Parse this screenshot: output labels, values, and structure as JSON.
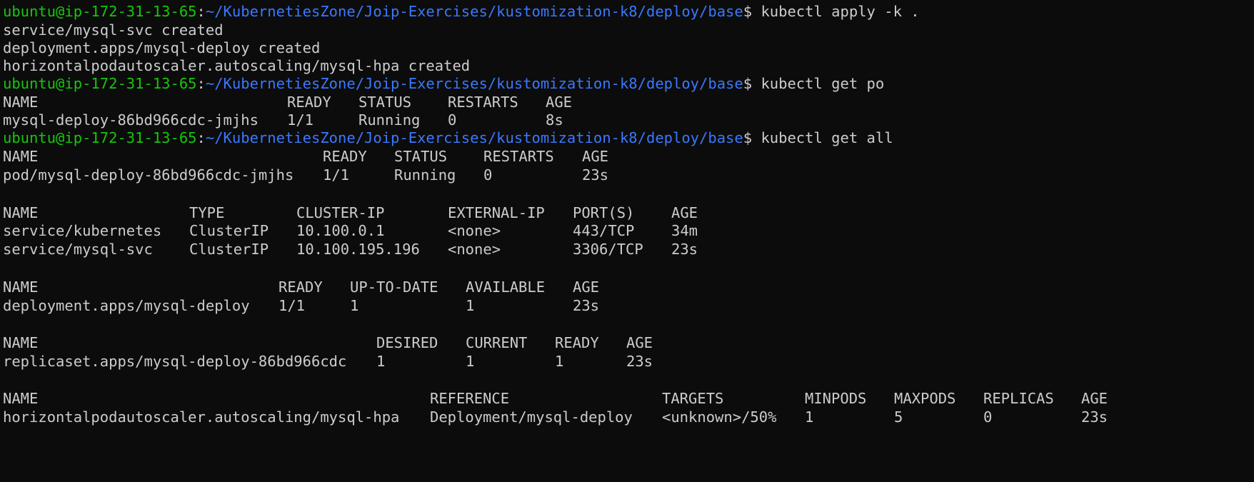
{
  "prompt": {
    "user_host": "ubuntu@ip-172-31-13-65",
    "separator": ":",
    "cwd": "~/KubernetiesZone/Joip-Exercises/kustomization-k8/deploy/base",
    "symbol": "$ "
  },
  "commands": {
    "apply": "kubectl apply -k .",
    "get_po": "kubectl get po",
    "get_all": "kubectl get all"
  },
  "apply_output": [
    "service/mysql-svc created",
    "deployment.apps/mysql-deploy created",
    "horizontalpodautoscaler.autoscaling/mysql-hpa created"
  ],
  "get_po": {
    "headers": [
      "NAME",
      "READY",
      "STATUS",
      "RESTARTS",
      "AGE"
    ],
    "rows": [
      [
        "mysql-deploy-86bd966cdc-jmjhs",
        "1/1",
        "Running",
        "0",
        "8s"
      ]
    ]
  },
  "get_all": {
    "pods": {
      "headers": [
        "NAME",
        "READY",
        "STATUS",
        "RESTARTS",
        "AGE"
      ],
      "rows": [
        [
          "pod/mysql-deploy-86bd966cdc-jmjhs",
          "1/1",
          "Running",
          "0",
          "23s"
        ]
      ]
    },
    "services": {
      "headers": [
        "NAME",
        "TYPE",
        "CLUSTER-IP",
        "EXTERNAL-IP",
        "PORT(S)",
        "AGE"
      ],
      "rows": [
        [
          "service/kubernetes",
          "ClusterIP",
          "10.100.0.1",
          "<none>",
          "443/TCP",
          "34m"
        ],
        [
          "service/mysql-svc",
          "ClusterIP",
          "10.100.195.196",
          "<none>",
          "3306/TCP",
          "23s"
        ]
      ]
    },
    "deployments": {
      "headers": [
        "NAME",
        "READY",
        "UP-TO-DATE",
        "AVAILABLE",
        "AGE"
      ],
      "rows": [
        [
          "deployment.apps/mysql-deploy",
          "1/1",
          "1",
          "1",
          "23s"
        ]
      ]
    },
    "replicasets": {
      "headers": [
        "NAME",
        "DESIRED",
        "CURRENT",
        "READY",
        "AGE"
      ],
      "rows": [
        [
          "replicaset.apps/mysql-deploy-86bd966cdc",
          "1",
          "1",
          "1",
          "23s"
        ]
      ]
    },
    "hpa": {
      "headers": [
        "NAME",
        "REFERENCE",
        "TARGETS",
        "MINPODS",
        "MAXPODS",
        "REPLICAS",
        "AGE"
      ],
      "rows": [
        [
          "horizontalpodautoscaler.autoscaling/mysql-hpa",
          "Deployment/mysql-deploy",
          "<unknown>/50%",
          "1",
          "5",
          "0",
          "23s"
        ]
      ]
    }
  },
  "colors": {
    "background": "#0c0c0c",
    "foreground": "#cccccc",
    "user_host": "#16c60c",
    "path": "#3b78ff"
  }
}
